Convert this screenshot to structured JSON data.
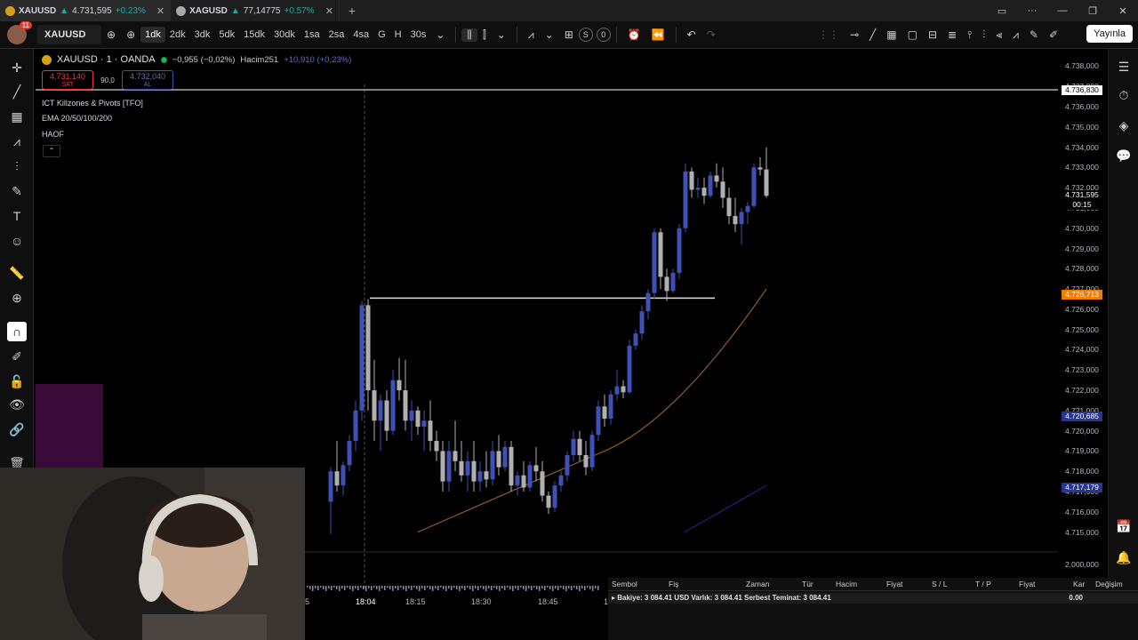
{
  "tabs": [
    {
      "symbol": "XAUUSD",
      "price": "4.731,595",
      "change": "+0.23%"
    },
    {
      "symbol": "XAGUSD",
      "price": "77,14775",
      "change": "+0.57%"
    }
  ],
  "toolbar": {
    "notifications": "11",
    "symbol": "XAUUSD",
    "timeframes": [
      "1dk",
      "2dk",
      "3dk",
      "5dk",
      "15dk",
      "30dk",
      "1sa",
      "2sa",
      "4sa",
      "G",
      "H",
      "30s"
    ],
    "selected_timeframe": "1dk",
    "s_label": "S",
    "o_label": "0",
    "publish": "Yayınla"
  },
  "legend": {
    "title": "XAUUSD · 1 · OANDA",
    "change": "−0,955 (−0,02%)",
    "volume_label": "Hacim",
    "volume": "251",
    "volume_change": "+10,910 (+0,23%)",
    "sell_price": "4.731,140",
    "sell_label": "SAT",
    "spread": "90,0",
    "buy_price": "4.732,040",
    "buy_label": "AL"
  },
  "indicators": [
    "ICT Killzones & Pivots [TFO]",
    "EMA 20/50/100/200",
    "HAOF"
  ],
  "price_axis": {
    "labels": [
      "4.738,000",
      "4.737,000",
      "4.736,000",
      "4.735,000",
      "4.734,000",
      "4.733,000",
      "4.732,000",
      "4.731,000",
      "4.730,000",
      "4.729,000",
      "4.728,000",
      "4.727,000",
      "4.726,000",
      "4.725,000",
      "4.724,000",
      "4.723,000",
      "4.722,000",
      "4.721,000",
      "4.720,000",
      "4.719,000",
      "4.718,000",
      "4.717,000",
      "4.716,000",
      "4.715,000"
    ],
    "volume_label": "2.000,000",
    "tags": [
      {
        "value": "4.736,830",
        "color": "#ffffff"
      },
      {
        "value": "4.731,595",
        "color": "#000000"
      },
      {
        "value": "00:15",
        "color": "#000000"
      },
      {
        "value": "4.726,713",
        "color": "#f57c00"
      },
      {
        "value": "4.720,685",
        "color": "#283593"
      },
      {
        "value": "4.717,179",
        "color": "#283593"
      }
    ]
  },
  "time_axis": [
    "5",
    "18:04",
    "18:15",
    "18:30",
    "18:45",
    "1"
  ],
  "chart_data": {
    "type": "candlestick",
    "symbol": "XAUUSD",
    "interval": "1",
    "ylim": [
      4714.5,
      4738.5
    ],
    "horizontal_lines": [
      4736.83,
      4726.55
    ],
    "ema_line": {
      "from": 4715.0,
      "to": 4727.0
    },
    "candles": [
      {
        "o": 4716.5,
        "h": 4718.2,
        "l": 4714.9,
        "c": 4718.0,
        "dir": "up"
      },
      {
        "o": 4718.0,
        "h": 4719.5,
        "l": 4717.0,
        "c": 4717.3,
        "dir": "down"
      },
      {
        "o": 4717.3,
        "h": 4718.5,
        "l": 4716.8,
        "c": 4718.3,
        "dir": "up"
      },
      {
        "o": 4718.3,
        "h": 4719.8,
        "l": 4718.0,
        "c": 4719.5,
        "dir": "up"
      },
      {
        "o": 4719.5,
        "h": 4721.5,
        "l": 4719.0,
        "c": 4721.0,
        "dir": "up"
      },
      {
        "o": 4721.0,
        "h": 4726.4,
        "l": 4720.5,
        "c": 4726.2,
        "dir": "up"
      },
      {
        "o": 4726.2,
        "h": 4726.5,
        "l": 4721.0,
        "c": 4722.0,
        "dir": "down"
      },
      {
        "o": 4722.0,
        "h": 4723.5,
        "l": 4719.5,
        "c": 4720.5,
        "dir": "down"
      },
      {
        "o": 4720.5,
        "h": 4721.8,
        "l": 4719.0,
        "c": 4721.5,
        "dir": "up"
      },
      {
        "o": 4721.5,
        "h": 4722.0,
        "l": 4719.5,
        "c": 4720.0,
        "dir": "down"
      },
      {
        "o": 4720.0,
        "h": 4723.0,
        "l": 4719.8,
        "c": 4722.5,
        "dir": "up"
      },
      {
        "o": 4722.5,
        "h": 4723.6,
        "l": 4721.5,
        "c": 4722.0,
        "dir": "down"
      },
      {
        "o": 4722.0,
        "h": 4723.5,
        "l": 4720.0,
        "c": 4720.5,
        "dir": "down"
      },
      {
        "o": 4720.5,
        "h": 4721.5,
        "l": 4719.5,
        "c": 4721.0,
        "dir": "up"
      },
      {
        "o": 4721.0,
        "h": 4721.2,
        "l": 4719.8,
        "c": 4720.2,
        "dir": "down"
      },
      {
        "o": 4720.2,
        "h": 4721.0,
        "l": 4719.0,
        "c": 4720.5,
        "dir": "up"
      },
      {
        "o": 4720.5,
        "h": 4721.5,
        "l": 4719.0,
        "c": 4719.5,
        "dir": "down"
      },
      {
        "o": 4719.5,
        "h": 4720.0,
        "l": 4718.5,
        "c": 4719.0,
        "dir": "down"
      },
      {
        "o": 4719.0,
        "h": 4719.5,
        "l": 4717.0,
        "c": 4717.5,
        "dir": "down"
      },
      {
        "o": 4717.5,
        "h": 4719.5,
        "l": 4717.0,
        "c": 4719.0,
        "dir": "up"
      },
      {
        "o": 4719.0,
        "h": 4720.5,
        "l": 4718.0,
        "c": 4718.5,
        "dir": "down"
      },
      {
        "o": 4718.5,
        "h": 4719.5,
        "l": 4717.5,
        "c": 4717.8,
        "dir": "down"
      },
      {
        "o": 4717.8,
        "h": 4719.0,
        "l": 4717.0,
        "c": 4718.5,
        "dir": "up"
      },
      {
        "o": 4718.5,
        "h": 4719.5,
        "l": 4717.0,
        "c": 4717.5,
        "dir": "down"
      },
      {
        "o": 4717.5,
        "h": 4718.5,
        "l": 4717.0,
        "c": 4718.0,
        "dir": "up"
      },
      {
        "o": 4718.0,
        "h": 4719.0,
        "l": 4717.2,
        "c": 4717.6,
        "dir": "down"
      },
      {
        "o": 4717.6,
        "h": 4719.5,
        "l": 4717.3,
        "c": 4719.0,
        "dir": "up"
      },
      {
        "o": 4719.0,
        "h": 4719.8,
        "l": 4717.8,
        "c": 4718.2,
        "dir": "down"
      },
      {
        "o": 4718.2,
        "h": 4719.5,
        "l": 4718.0,
        "c": 4719.2,
        "dir": "up"
      },
      {
        "o": 4719.2,
        "h": 4719.5,
        "l": 4717.0,
        "c": 4717.3,
        "dir": "down"
      },
      {
        "o": 4717.3,
        "h": 4718.0,
        "l": 4716.8,
        "c": 4717.8,
        "dir": "up"
      },
      {
        "o": 4717.8,
        "h": 4718.5,
        "l": 4717.0,
        "c": 4717.2,
        "dir": "down"
      },
      {
        "o": 4717.2,
        "h": 4718.5,
        "l": 4717.0,
        "c": 4718.3,
        "dir": "up"
      },
      {
        "o": 4718.3,
        "h": 4719.2,
        "l": 4717.5,
        "c": 4718.0,
        "dir": "down"
      },
      {
        "o": 4718.0,
        "h": 4718.5,
        "l": 4716.5,
        "c": 4716.8,
        "dir": "down"
      },
      {
        "o": 4716.8,
        "h": 4717.0,
        "l": 4715.9,
        "c": 4716.2,
        "dir": "down"
      },
      {
        "o": 4716.2,
        "h": 4717.5,
        "l": 4716.0,
        "c": 4717.3,
        "dir": "up"
      },
      {
        "o": 4717.3,
        "h": 4718.0,
        "l": 4717.0,
        "c": 4717.8,
        "dir": "up"
      },
      {
        "o": 4717.8,
        "h": 4719.0,
        "l": 4717.5,
        "c": 4718.8,
        "dir": "up"
      },
      {
        "o": 4718.8,
        "h": 4720.0,
        "l": 4718.5,
        "c": 4719.6,
        "dir": "up"
      },
      {
        "o": 4719.6,
        "h": 4720.0,
        "l": 4718.5,
        "c": 4718.8,
        "dir": "down"
      },
      {
        "o": 4718.8,
        "h": 4719.5,
        "l": 4717.8,
        "c": 4718.2,
        "dir": "down"
      },
      {
        "o": 4718.2,
        "h": 4720.0,
        "l": 4718.0,
        "c": 4719.8,
        "dir": "up"
      },
      {
        "o": 4719.8,
        "h": 4721.5,
        "l": 4719.5,
        "c": 4721.2,
        "dir": "up"
      },
      {
        "o": 4721.2,
        "h": 4721.8,
        "l": 4720.2,
        "c": 4720.6,
        "dir": "down"
      },
      {
        "o": 4720.6,
        "h": 4722.0,
        "l": 4720.3,
        "c": 4721.8,
        "dir": "up"
      },
      {
        "o": 4721.8,
        "h": 4723.0,
        "l": 4721.5,
        "c": 4722.2,
        "dir": "up"
      },
      {
        "o": 4722.2,
        "h": 4722.5,
        "l": 4721.6,
        "c": 4721.9,
        "dir": "down"
      },
      {
        "o": 4721.9,
        "h": 4724.5,
        "l": 4721.8,
        "c": 4724.2,
        "dir": "up"
      },
      {
        "o": 4724.2,
        "h": 4725.0,
        "l": 4724.0,
        "c": 4724.8,
        "dir": "up"
      },
      {
        "o": 4724.8,
        "h": 4726.2,
        "l": 4724.5,
        "c": 4725.9,
        "dir": "up"
      },
      {
        "o": 4725.9,
        "h": 4727.0,
        "l": 4725.5,
        "c": 4726.8,
        "dir": "up"
      },
      {
        "o": 4726.8,
        "h": 4730.0,
        "l": 4726.5,
        "c": 4729.8,
        "dir": "up"
      },
      {
        "o": 4729.8,
        "h": 4730.0,
        "l": 4727.0,
        "c": 4727.6,
        "dir": "down"
      },
      {
        "o": 4727.6,
        "h": 4728.0,
        "l": 4726.4,
        "c": 4726.9,
        "dir": "down"
      },
      {
        "o": 4726.9,
        "h": 4728.0,
        "l": 4726.8,
        "c": 4727.8,
        "dir": "up"
      },
      {
        "o": 4727.8,
        "h": 4730.2,
        "l": 4727.5,
        "c": 4730.0,
        "dir": "up"
      },
      {
        "o": 4730.0,
        "h": 4733.2,
        "l": 4729.8,
        "c": 4732.8,
        "dir": "up"
      },
      {
        "o": 4732.8,
        "h": 4733.0,
        "l": 4731.5,
        "c": 4731.9,
        "dir": "down"
      },
      {
        "o": 4731.9,
        "h": 4732.5,
        "l": 4731.5,
        "c": 4732.0,
        "dir": "up"
      },
      {
        "o": 4732.0,
        "h": 4732.5,
        "l": 4731.2,
        "c": 4731.6,
        "dir": "down"
      },
      {
        "o": 4731.6,
        "h": 4732.8,
        "l": 4731.5,
        "c": 4732.6,
        "dir": "up"
      },
      {
        "o": 4732.6,
        "h": 4733.2,
        "l": 4732.0,
        "c": 4732.3,
        "dir": "down"
      },
      {
        "o": 4732.3,
        "h": 4733.0,
        "l": 4731.0,
        "c": 4731.5,
        "dir": "down"
      },
      {
        "o": 4731.5,
        "h": 4732.0,
        "l": 4730.2,
        "c": 4730.6,
        "dir": "down"
      },
      {
        "o": 4730.6,
        "h": 4731.5,
        "l": 4729.8,
        "c": 4730.2,
        "dir": "down"
      },
      {
        "o": 4730.2,
        "h": 4731.0,
        "l": 4729.2,
        "c": 4730.8,
        "dir": "up"
      },
      {
        "o": 4730.8,
        "h": 4731.3,
        "l": 4730.2,
        "c": 4731.1,
        "dir": "up"
      },
      {
        "o": 4731.1,
        "h": 4733.2,
        "l": 4731.0,
        "c": 4733.0,
        "dir": "up"
      },
      {
        "o": 4733.0,
        "h": 4733.5,
        "l": 4732.6,
        "c": 4732.9,
        "dir": "down"
      },
      {
        "o": 4732.9,
        "h": 4734.0,
        "l": 4731.5,
        "c": 4731.6,
        "dir": "down"
      }
    ]
  },
  "panel": {
    "headers": [
      "Sembol",
      "Fiş",
      "Zaman",
      "Tür",
      "Hacim",
      "Fiyat",
      "S / L",
      "T / P",
      "Fiyat",
      "Kar",
      "Değişim"
    ],
    "balance": "Bakiye: 3 084.41 USD  Varlık: 3 084.41  Serbest Teminat: 3 084.41",
    "profit": "0.00"
  },
  "colors": {
    "up": "#3f51b5",
    "down": "#b0b0b0",
    "ema": "#8d5a2b",
    "ema_blue": "#1a237e"
  }
}
